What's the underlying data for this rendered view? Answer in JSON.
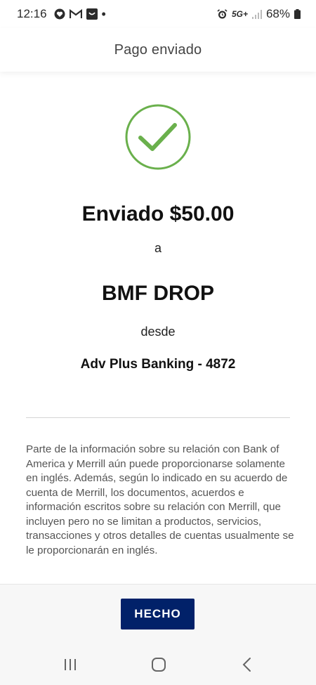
{
  "status_bar": {
    "time": "12:16",
    "network": "5G+",
    "battery": "68%",
    "icons": [
      "heart-icon",
      "gmail-icon",
      "inbox-icon",
      "dot-icon",
      "alarm-icon",
      "signal-icon",
      "battery-icon"
    ]
  },
  "header": {
    "title": "Pago enviado"
  },
  "confirmation": {
    "icon": "checkmark-circle-icon",
    "icon_color": "#6ab04c",
    "amount_line": "Enviado $50.00",
    "connector_to": "a",
    "recipient": "BMF DROP",
    "connector_from": "desde",
    "account": "Adv Plus Banking - 4872"
  },
  "disclaimer": {
    "text": "Parte de la información sobre su relación con Bank of America y Merrill aún puede proporcionarse solamente en inglés. Además, según lo indicado en su acuerdo de cuenta de Merrill, los documentos, acuerdos e información escritos sobre su relación con Merrill, que incluyen pero no se limitan a productos, servicios, transacciones y otros detalles de cuentas usualmente se le proporcionarán en inglés."
  },
  "footer": {
    "done_label": "HECHO",
    "button_color": "#012169"
  },
  "system_nav": {
    "icons": [
      "recents-icon",
      "home-icon",
      "back-icon"
    ]
  }
}
